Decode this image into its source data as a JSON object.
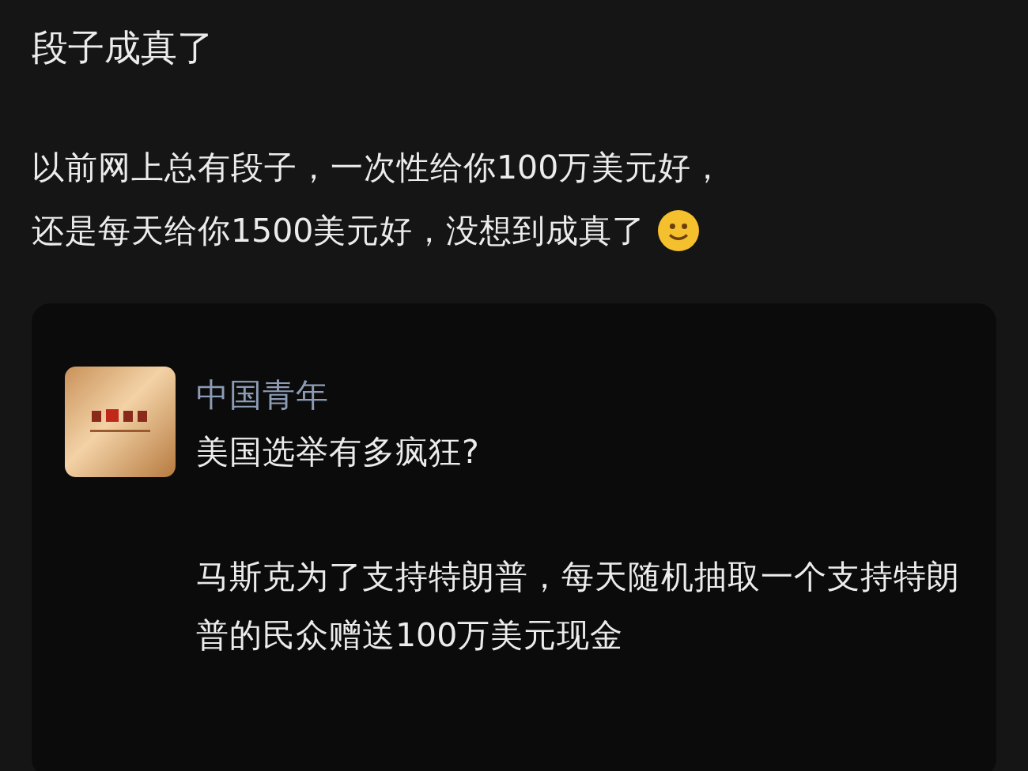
{
  "post": {
    "title": "段子成真了",
    "body": [
      "以前网上总有段子，一次性给你100万美元好，",
      "还是每天给你1500美元好，没想到成真了"
    ]
  },
  "quote": {
    "author": "中国青年",
    "paragraphs": [
      "美国选举有多疯狂?",
      "马斯克为了支持特朗普，每天随机抽取一个支持特朗普的民众赠送100万美元现金"
    ]
  }
}
